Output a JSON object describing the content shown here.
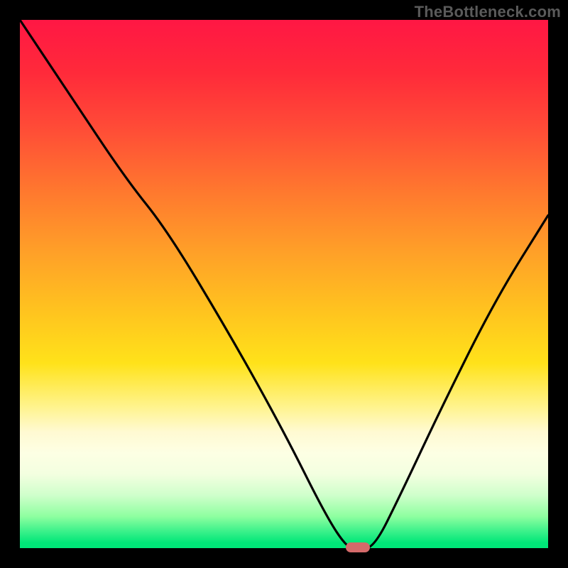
{
  "watermark": "TheBottleneck.com",
  "chart_data": {
    "type": "line",
    "title": "",
    "xlabel": "",
    "ylabel": "",
    "xlim": [
      0,
      100
    ],
    "ylim": [
      0,
      100
    ],
    "grid": false,
    "legend": false,
    "series": [
      {
        "name": "bottleneck-curve",
        "x": [
          0,
          10,
          20,
          28,
          40,
          50,
          58,
          62,
          64,
          67,
          72,
          80,
          90,
          100
        ],
        "y": [
          100,
          85,
          70,
          60,
          40,
          22,
          6,
          0,
          0,
          0,
          10,
          27,
          47,
          63
        ]
      }
    ],
    "marker": {
      "x": 64,
      "y": 0,
      "color": "#d46a6a"
    },
    "gradient_stops": [
      {
        "pct": 0,
        "color": "#ff1744"
      },
      {
        "pct": 33,
        "color": "#ff7a2e"
      },
      {
        "pct": 65,
        "color": "#ffe21a"
      },
      {
        "pct": 85,
        "color": "#f3ffe0"
      },
      {
        "pct": 100,
        "color": "#00e778"
      }
    ]
  }
}
